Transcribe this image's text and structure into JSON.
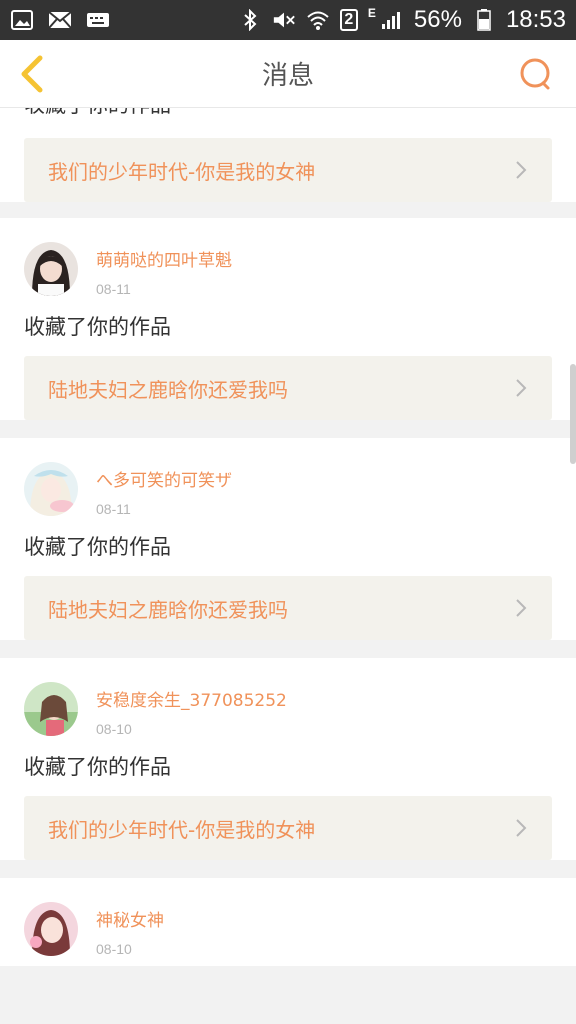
{
  "status_bar": {
    "battery": "56%",
    "time": "18:53",
    "sim": "2",
    "network_type": "E",
    "icons": [
      "image-icon",
      "mail-icon",
      "keyboard-icon",
      "bluetooth-icon",
      "mute-icon",
      "wifi-icon",
      "signal-icon",
      "battery-icon"
    ]
  },
  "header": {
    "title": "消息",
    "back_icon": "back-chevron-icon",
    "search_icon": "search-icon"
  },
  "colors": {
    "accent": "#f0925a",
    "back": "#f5c333",
    "search": "#f0925a"
  },
  "messages": [
    {
      "action": "收藏了你的作品",
      "work_title": "我们的少年时代-你是我的女神"
    },
    {
      "user": "萌萌哒的四叶草魁",
      "date": "08-11",
      "action": "收藏了你的作品",
      "work_title": "陆地夫妇之鹿晗你还爱我吗"
    },
    {
      "user": "へ多可笑的可笑ザ",
      "date": "08-11",
      "action": "收藏了你的作品",
      "work_title": "陆地夫妇之鹿晗你还爱我吗"
    },
    {
      "user": "安稳度余生_377085252",
      "date": "08-10",
      "action": "收藏了你的作品",
      "work_title": "我们的少年时代-你是我的女神"
    },
    {
      "user": "神秘女神",
      "date": "08-10"
    }
  ]
}
